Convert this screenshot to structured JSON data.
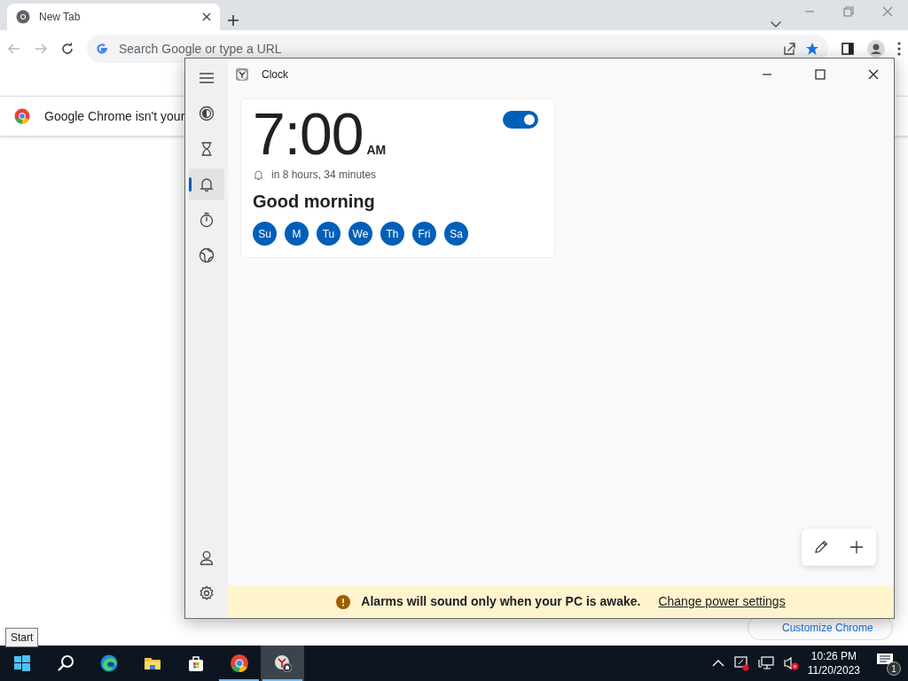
{
  "chrome": {
    "tab": {
      "title": "New Tab"
    },
    "omnibox": {
      "placeholder": "Search Google or type a URL"
    },
    "bookmarked": true,
    "infobar": {
      "text": "Google Chrome isn't your"
    },
    "customize_button": "Customize Chrome"
  },
  "clock_app": {
    "title": "Clock",
    "nav": [
      {
        "kind": "focus",
        "selected": false
      },
      {
        "kind": "timer",
        "selected": false
      },
      {
        "kind": "alarm",
        "selected": true
      },
      {
        "kind": "stopwatch",
        "selected": false
      },
      {
        "kind": "world",
        "selected": false
      }
    ],
    "nav_bottom": [
      {
        "kind": "account"
      },
      {
        "kind": "settings"
      }
    ],
    "alarms": [
      {
        "time": "7:00",
        "period": "AM",
        "countdown": "in 8 hours, 34 minutes",
        "name": "Good morning",
        "on": true,
        "days": [
          {
            "label": "Su",
            "selected": true
          },
          {
            "label": "M",
            "selected": true
          },
          {
            "label": "Tu",
            "selected": true
          },
          {
            "label": "We",
            "selected": true
          },
          {
            "label": "Th",
            "selected": true
          },
          {
            "label": "Fri",
            "selected": true
          },
          {
            "label": "Sa",
            "selected": true
          }
        ]
      }
    ],
    "notice": {
      "text": "Alarms will sound only when your PC is awake.",
      "link": "Change power settings"
    }
  },
  "taskbar": {
    "tooltip": "Start",
    "apps": [
      {
        "kind": "start",
        "running": false,
        "active": false
      },
      {
        "kind": "search",
        "running": false,
        "active": false
      },
      {
        "kind": "edge",
        "running": false,
        "active": false
      },
      {
        "kind": "explorer",
        "running": false,
        "active": false
      },
      {
        "kind": "store",
        "running": false,
        "active": false
      },
      {
        "kind": "chrome",
        "running": true,
        "active": false
      },
      {
        "kind": "clock",
        "running": true,
        "active": true
      }
    ],
    "time": "10:26 PM",
    "date": "11/20/2023",
    "notifications": "1"
  }
}
